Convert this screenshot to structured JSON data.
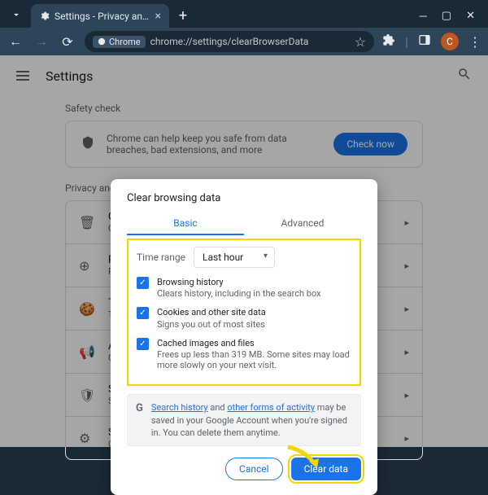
{
  "tab": {
    "title": "Settings - Privacy and security"
  },
  "omnibox": {
    "chip": "Chrome",
    "url": "chrome://settings/clearBrowserData"
  },
  "avatar_letter": "C",
  "page_title": "Settings",
  "safety": {
    "heading": "Safety check",
    "text": "Chrome can help keep you safe from data breaches, bad extensions, and more",
    "button": "Check now"
  },
  "privacy": {
    "heading": "Privacy and security",
    "rows": [
      {
        "title": "Clear browsing data",
        "sub": "Clear history, cookies, cache, and more"
      },
      {
        "title": "Privacy Guide",
        "sub": "Review key privacy and security controls"
      },
      {
        "title": "Third-party cookies",
        "sub": "Third-party cookies are blocked in Incognito mode"
      },
      {
        "title": "Ad privacy",
        "sub": "Customize the info used by sites to show you ads"
      },
      {
        "title": "Security",
        "sub": "Safe Browsing and other security settings"
      },
      {
        "title": "Site settings",
        "sub": "Controls what information sites can use and show"
      }
    ]
  },
  "dialog": {
    "title": "Clear browsing data",
    "tab_basic": "Basic",
    "tab_advanced": "Advanced",
    "time_range_label": "Time range",
    "time_range_value": "Last hour",
    "items": [
      {
        "title": "Browsing history",
        "sub": "Clears history, including in the search box"
      },
      {
        "title": "Cookies and other site data",
        "sub": "Signs you out of most sites"
      },
      {
        "title": "Cached images and files",
        "sub": "Frees up less than 319 MB. Some sites may load more slowly on your next visit."
      }
    ],
    "notice": {
      "link1": "Search history",
      "mid": " and ",
      "link2": "other forms of activity",
      "tail": " may be saved in your Google Account when you're signed in. You can delete them anytime."
    },
    "btn_cancel": "Cancel",
    "btn_clear": "Clear data"
  }
}
